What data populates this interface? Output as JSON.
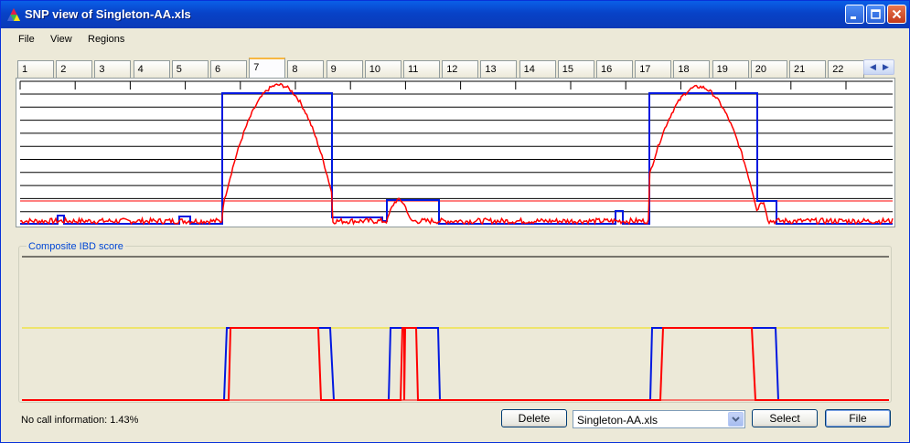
{
  "window": {
    "title": "SNP view of Singleton-AA.xls"
  },
  "menu": {
    "items": [
      "File",
      "View",
      "Regions"
    ]
  },
  "tabs": {
    "labels": [
      "1",
      "2",
      "3",
      "4",
      "5",
      "6",
      "7",
      "8",
      "9",
      "10",
      "11",
      "12",
      "13",
      "14",
      "15",
      "16",
      "17",
      "18",
      "19",
      "20",
      "21",
      "22"
    ],
    "active": "7"
  },
  "composite": {
    "label": "Composite IBD score"
  },
  "status": {
    "no_call_text": "No call information: 1.43%"
  },
  "buttons": {
    "delete": "Delete",
    "select": "Select",
    "file": "File"
  },
  "file_combo": {
    "value": "Singleton-AA.xls"
  },
  "colors": {
    "series_blue": "#0018e0",
    "series_red": "#ff0000",
    "threshold_yellow": "#f0e000",
    "title_bar": "#0842c7"
  },
  "icons": {
    "app": "pyramid-icon",
    "minimize": "minimize-icon",
    "maximize": "maximize-icon",
    "close": "close-icon",
    "tab_left": "arrow-left-icon",
    "tab_right": "arrow-right-icon",
    "combo": "chevron-down-icon"
  }
}
